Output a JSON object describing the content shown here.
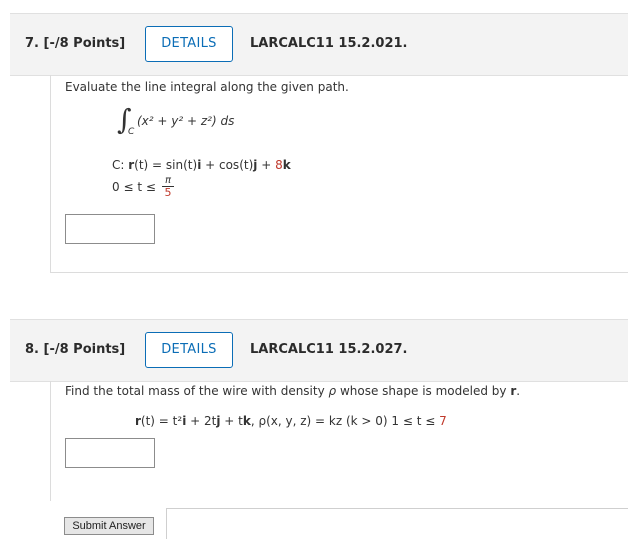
{
  "q7": {
    "number": "7.",
    "points": "[-/8 Points]",
    "details_label": "DETAILS",
    "code": "LARCALC11 15.2.021.",
    "prompt": "Evaluate the line integral along the given path.",
    "integrand": "(x² + y² + z²) ds",
    "integral_sub": "C",
    "path_label": "C: ",
    "path_r": "r",
    "path_rest": "(t) = sin(t)",
    "path_i": "i",
    "path_mid": " + cos(t)",
    "path_j": "j",
    "path_plus": " + ",
    "path_coef": "8",
    "path_k": "k",
    "range_left": "0 ≤ t ≤",
    "range_num": "π",
    "range_den": "5"
  },
  "q8": {
    "number": "8.",
    "points": "[-/8 Points]",
    "details_label": "DETAILS",
    "code": "LARCALC11 15.2.027.",
    "prompt_text": "Find the total mass of the wire with density ",
    "prompt_rho": "ρ",
    "prompt_mid": " whose shape is modeled by ",
    "prompt_r": "r",
    "prompt_end": ".",
    "eq_r": "r",
    "eq_main": "(t) = t²",
    "eq_i": "i",
    "eq_mid": " + 2t",
    "eq_j": "j",
    "eq_mid2": " + t",
    "eq_k": "k",
    "eq_density": ",   ρ(x, y, z) = kz   (k > 0)   1 ≤ t ≤ ",
    "eq_upper": "7"
  },
  "submit_label": "Submit Answer"
}
